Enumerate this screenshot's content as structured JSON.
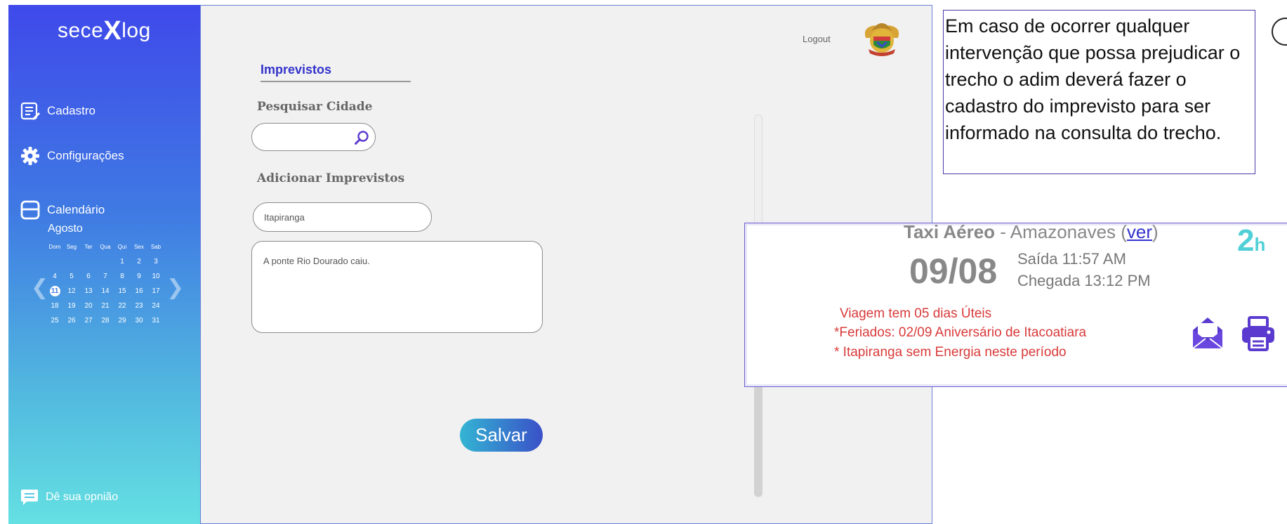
{
  "sidebar": {
    "logo_left": "sece",
    "logo_x": "X",
    "logo_right": "log",
    "nav": {
      "cadastro": "Cadastro",
      "configuracoes": "Configurações",
      "calendario": "Calendário"
    },
    "calendar": {
      "month": "Agosto",
      "weekdays": [
        "Dom",
        "Seg",
        "Ter",
        "Qua",
        "Qui",
        "Sex",
        "Sab"
      ],
      "weeks": [
        [
          "",
          "",
          "",
          "",
          "1",
          "2",
          "3"
        ],
        [
          "4",
          "5",
          "6",
          "7",
          "8",
          "9",
          "10"
        ],
        [
          "11",
          "12",
          "13",
          "14",
          "15",
          "16",
          "17"
        ],
        [
          "18",
          "19",
          "20",
          "21",
          "22",
          "23",
          "24"
        ],
        [
          "25",
          "26",
          "27",
          "28",
          "29",
          "30",
          "31"
        ]
      ],
      "selected_day": "11",
      "prev_arrow": "❮",
      "next_arrow": "❯"
    },
    "feedback": "Dê sua opnião"
  },
  "header": {
    "logout": "Logout"
  },
  "form": {
    "tab_title": "Imprevistos",
    "search_label": "Pesquisar Cidade",
    "search_value": "",
    "add_label": "Adicionar Imprevistos",
    "city_value": "Itapiranga",
    "description_value": "A ponte Rio Dourado caiu.",
    "save_label": "Salvar"
  },
  "note": {
    "text": "Em caso de ocorrer qualquer intervenção que possa prejudicar o trecho o adim deverá fazer o cadastro do imprevisto para ser informado na consulta do trecho."
  },
  "trip": {
    "type": "Taxi Aéreo",
    "separator": " - ",
    "company": "Amazonaves (",
    "link": "ver",
    "company_close": ")",
    "date": "09/08",
    "departure": "Saída 11:57 AM",
    "arrival": "Chegada 13:12 PM",
    "duration_value": "2",
    "duration_unit": "h",
    "warnings": [
      "Viagem tem 05 dias Úteis",
      "*Feriados: 02/09 Aniversário de Itacoatiara",
      "* Itapiranga sem Energia neste período"
    ]
  },
  "colors": {
    "sidebar_top": "#3f49ea",
    "sidebar_bottom": "#64e0e2",
    "accent": "#3333cc",
    "warning": "#d93a3a",
    "duration": "#4fd0d6"
  },
  "icons": [
    "cadastro-icon",
    "gear-icon",
    "calendar-icon",
    "chat-icon",
    "crest-icon",
    "search-icon",
    "mail-icon",
    "print-icon"
  ]
}
